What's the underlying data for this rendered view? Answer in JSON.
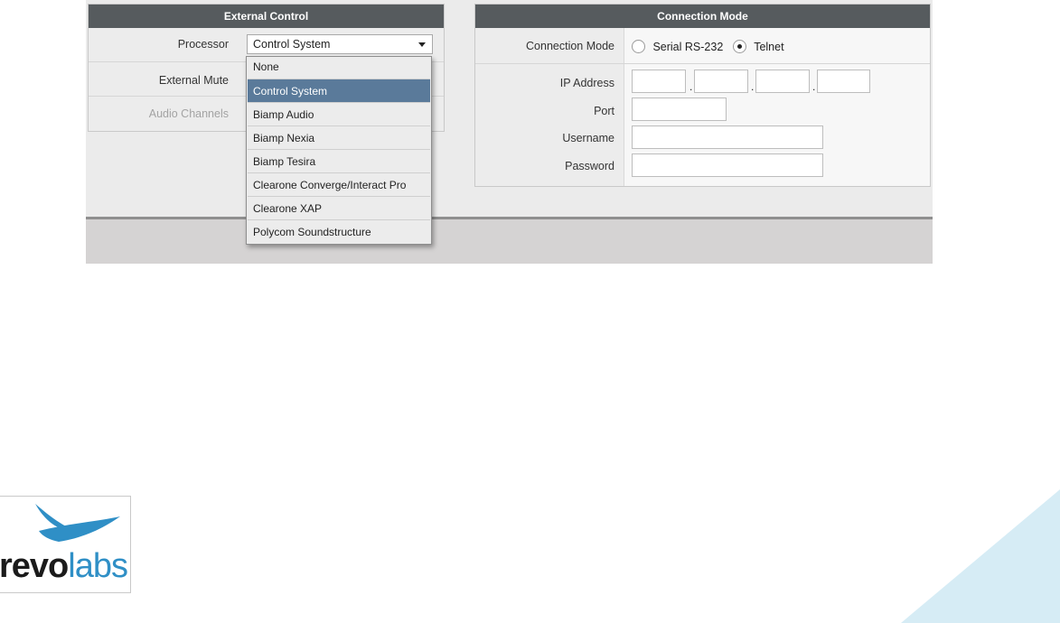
{
  "external_control": {
    "title": "External Control",
    "processor_label": "Processor",
    "processor_value": "Control System",
    "external_mute_label": "External Mute",
    "audio_channels_label": "Audio Channels",
    "processor_options": [
      "None",
      "Control System",
      "Biamp Audio",
      "Biamp Nexia",
      "Biamp Tesira",
      "Clearone Converge/Interact Pro",
      "Clearone XAP",
      "Polycom Soundstructure"
    ]
  },
  "connection_mode": {
    "title": "Connection Mode",
    "mode_label": "Connection Mode",
    "serial_label": "Serial RS-232",
    "telnet_label": "Telnet",
    "selected_mode": "Telnet",
    "ip_label": "IP Address",
    "ip_separator": ".",
    "port_label": "Port",
    "username_label": "Username",
    "password_label": "Password"
  },
  "brand": {
    "logo_text_dark": "revo",
    "logo_text_light": "labs",
    "logo_dark_color": "#1b1b1b",
    "logo_light_color": "#2f8fc6",
    "accent_light_blue": "#d6ecf5"
  }
}
